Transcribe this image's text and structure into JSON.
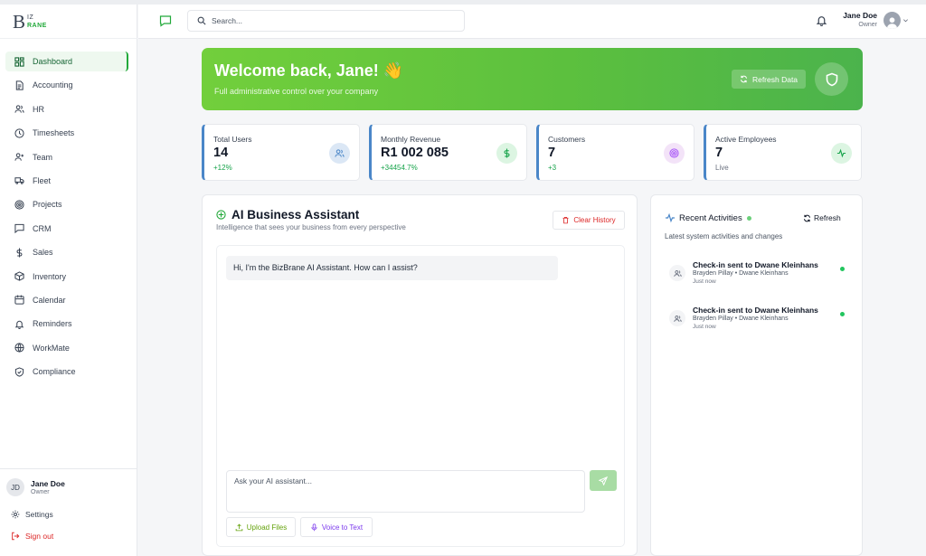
{
  "brand": {
    "logo_b": "B",
    "logo_iz": "IZ",
    "logo_rane": "RANE"
  },
  "header": {
    "search_placeholder": "Search...",
    "user_name": "Jane Doe",
    "user_role": "Owner"
  },
  "sidebar": {
    "items": [
      {
        "label": "Dashboard",
        "icon": "dashboard-icon",
        "active": true
      },
      {
        "label": "Accounting",
        "icon": "document-icon"
      },
      {
        "label": "HR",
        "icon": "users-icon"
      },
      {
        "label": "Timesheets",
        "icon": "clock-icon"
      },
      {
        "label": "Team",
        "icon": "user-plus-icon"
      },
      {
        "label": "Fleet",
        "icon": "truck-icon"
      },
      {
        "label": "Projects",
        "icon": "target-icon"
      },
      {
        "label": "CRM",
        "icon": "message-icon"
      },
      {
        "label": "Sales",
        "icon": "dollar-icon"
      },
      {
        "label": "Inventory",
        "icon": "box-icon"
      },
      {
        "label": "Calendar",
        "icon": "calendar-icon"
      },
      {
        "label": "Reminders",
        "icon": "bell-icon"
      },
      {
        "label": "WorkMate",
        "icon": "globe-icon"
      },
      {
        "label": "Compliance",
        "icon": "shield-check-icon"
      }
    ],
    "user_initials": "JD",
    "user_name": "Jane Doe",
    "user_role": "Owner",
    "settings_label": "Settings",
    "signout_label": "Sign out"
  },
  "banner": {
    "title": "Welcome back, Jane! 👋",
    "subtitle": "Full administrative control over your company",
    "refresh_label": "Refresh Data"
  },
  "stats": [
    {
      "label": "Total Users",
      "value": "14",
      "change": "+12%",
      "icon": "users-icon",
      "color": "#4a86c8"
    },
    {
      "label": "Monthly Revenue",
      "value": "R1 002 085",
      "change": "+34454.7%",
      "icon": "dollar-icon",
      "color": "#22c55e"
    },
    {
      "label": "Customers",
      "value": "7",
      "change": "+3",
      "icon": "target-icon",
      "color": "#a855f7"
    },
    {
      "label": "Active Employees",
      "value": "7",
      "change": "Live",
      "icon": "activity-icon",
      "color": "#22c55e"
    }
  ],
  "assistant": {
    "title": "AI Business Assistant",
    "subtitle": "Intelligence that sees your business from every perspective",
    "clear_label": "Clear History",
    "greeting": "Hi, I'm the BizBrane AI Assistant. How can I assist?",
    "input_placeholder": "Ask your AI assistant...",
    "upload_label": "Upload Files",
    "voice_label": "Voice to Text"
  },
  "activities": {
    "title": "Recent Activities",
    "refresh_label": "Refresh",
    "subtitle": "Latest system activities and changes",
    "items": [
      {
        "title": "Check-in sent to Dwane Kleinhans",
        "people": "Brayden Pillay • Dwane Kleinhans",
        "time": "Just now"
      },
      {
        "title": "Check-in sent to Dwane Kleinhans",
        "people": "Brayden Pillay • Dwane Kleinhans",
        "time": "Just now"
      }
    ]
  },
  "colors": {
    "brand_green": "#22a93a",
    "accent_blue": "#4a86c8",
    "danger": "#dc2626"
  }
}
